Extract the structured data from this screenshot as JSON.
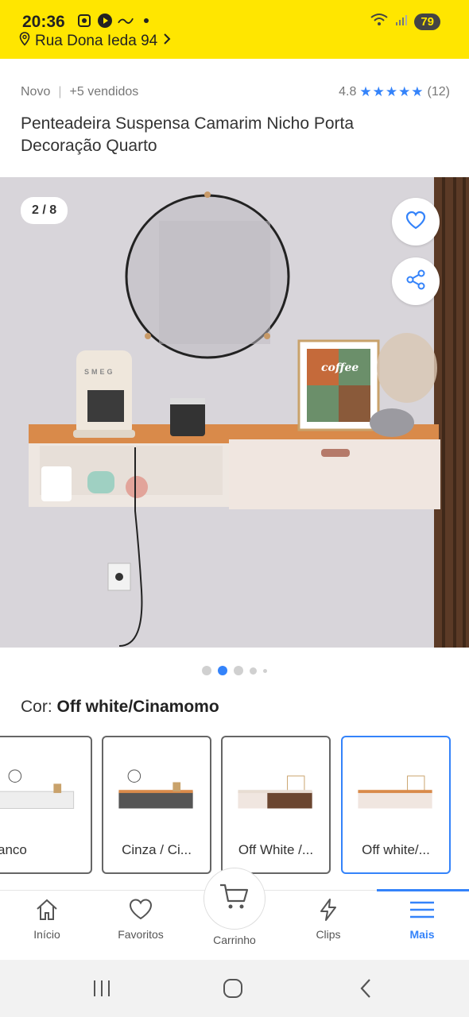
{
  "status": {
    "time": "20:36",
    "battery": "79"
  },
  "address": {
    "text": "Rua Dona Ieda 94"
  },
  "product": {
    "condition": "Novo",
    "sold": "+5 vendidos",
    "rating": "4.8",
    "stars": "★★★★★",
    "reviews": "(12)",
    "title": "Penteadeira Suspensa Camarim Nicho Porta Decoração Quarto"
  },
  "gallery": {
    "counter": "2 / 8",
    "coffee_sign": "coffee",
    "appliance_brand": "SMEG"
  },
  "color": {
    "label": "Cor: ",
    "value": "Off white/Cinamomo"
  },
  "variants": [
    {
      "label": "Branco"
    },
    {
      "label": "Cinza / Ci..."
    },
    {
      "label": "Off White /..."
    },
    {
      "label": "Off white/..."
    }
  ],
  "nav": {
    "inicio": "Início",
    "favoritos": "Favoritos",
    "carrinho": "Carrinho",
    "clips": "Clips",
    "mais": "Mais"
  },
  "colors": {
    "brand_yellow": "#FFE600",
    "accent_blue": "#3483FA"
  },
  "icons": [
    "location-pin-icon",
    "chevron-right-icon",
    "star-icon",
    "heart-icon",
    "share-icon",
    "home-icon",
    "cart-icon",
    "lightning-icon",
    "menu-icon"
  ]
}
